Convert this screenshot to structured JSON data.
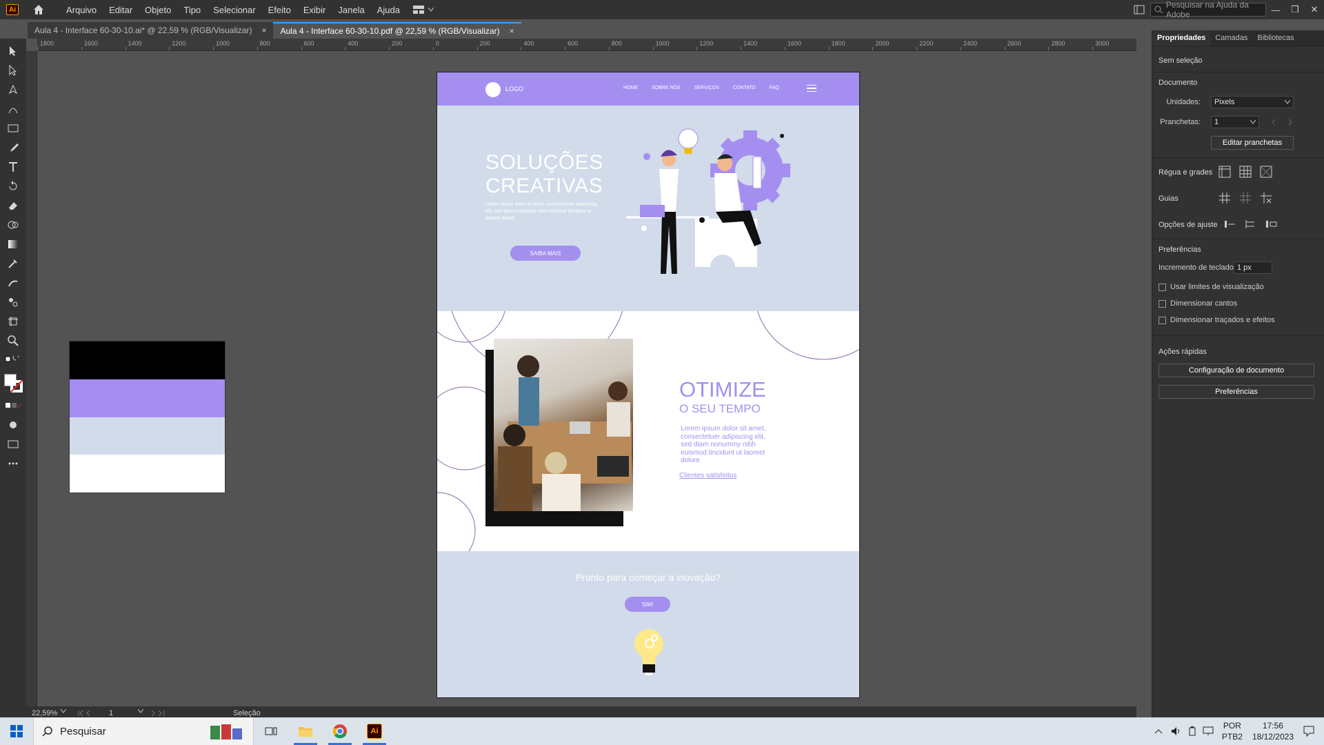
{
  "app": {
    "logo_text": "Ai",
    "menu": [
      "Arquivo",
      "Editar",
      "Objeto",
      "Tipo",
      "Selecionar",
      "Efeito",
      "Exibir",
      "Janela",
      "Ajuda"
    ],
    "help_search_placeholder": "Pesquisar na Ajuda da Adobe",
    "window_controls": [
      "—",
      "❐",
      "✕"
    ]
  },
  "tabs": [
    {
      "label": "Aula 4 - Interface 60-30-10.ai* @ 22,59 % (RGB/Visualizar)",
      "close": "×",
      "active": false
    },
    {
      "label": "Aula 4 - Interface 60-30-10.pdf @ 22,59 % (RGB/Visualizar)",
      "close": "×",
      "active": true
    }
  ],
  "ruler_top_labels": [
    "1800",
    "1600",
    "1400",
    "1200",
    "1000",
    "800",
    "600",
    "400",
    "200",
    "0",
    "200",
    "400",
    "600",
    "800",
    "1000",
    "1200",
    "1400",
    "1600",
    "1800",
    "2000",
    "2200",
    "2400",
    "2600",
    "2800",
    "3000"
  ],
  "swatch_colors": [
    "#000000",
    "#a48ff1",
    "#d1dbea",
    "#ffffff"
  ],
  "website": {
    "logo": "LOGO",
    "nav": [
      "HOME",
      "SOBRE NÓS",
      "SERVIÇOS",
      "CONTATO",
      "FAQ"
    ],
    "hero": {
      "title_line1": "SOLUÇÕES",
      "title_line2": "CREATIVAS",
      "text": "Lorem ipsum dolor sit amet, consectetuer adipiscing elit, sed diam nonummy nibh euismod tincidunt ut laoreet dolore",
      "button": "SAIBA MAIS"
    },
    "features": {
      "title": "OTIMIZE",
      "subtitle": "O SEU TEMPO",
      "text": "Lorem ipsum dolor sit amet, consectetuer adipiscing elit, sed diam nonummy nibh euismod tincidunt ut laoreet dolore",
      "link": "Clientes satisfeitos"
    },
    "cta": {
      "text": "Pronto para começar a inovação?",
      "button": "SIM!"
    },
    "colors": {
      "primary": "#a48ff1",
      "secondary": "#d1dbea",
      "dark": "#000000",
      "light": "#ffffff"
    }
  },
  "panel": {
    "tabs": [
      "Propriedades",
      "Camadas",
      "Bibliotecas"
    ],
    "selection": "Sem seleção",
    "document_title": "Documento",
    "units_label": "Unidades:",
    "units_value": "Pixels",
    "artboards_label": "Pranchetas:",
    "artboards_value": "1",
    "edit_artboards": "Editar pranchetas",
    "ruler_grids": "Régua e grades",
    "guides": "Guias",
    "snap_options": "Opções de ajuste",
    "preferences_title": "Preferências",
    "keyboard_increment_label": "Incremento de teclado:",
    "keyboard_increment_value": "1 px",
    "checkboxes": [
      "Usar limites de visualização",
      "Dimensionar cantos",
      "Dimensionar traçados e efeitos"
    ],
    "quick_actions": "Ações rápidas",
    "doc_setup_button": "Configuração de documento",
    "prefs_button": "Preferências"
  },
  "status": {
    "zoom": "22,59%",
    "artboard": "1",
    "tool": "Seleção"
  },
  "taskbar": {
    "search": "Pesquisar",
    "lang1": "POR",
    "lang2": "PTB2",
    "time": "17:56",
    "date": "18/12/2023"
  }
}
